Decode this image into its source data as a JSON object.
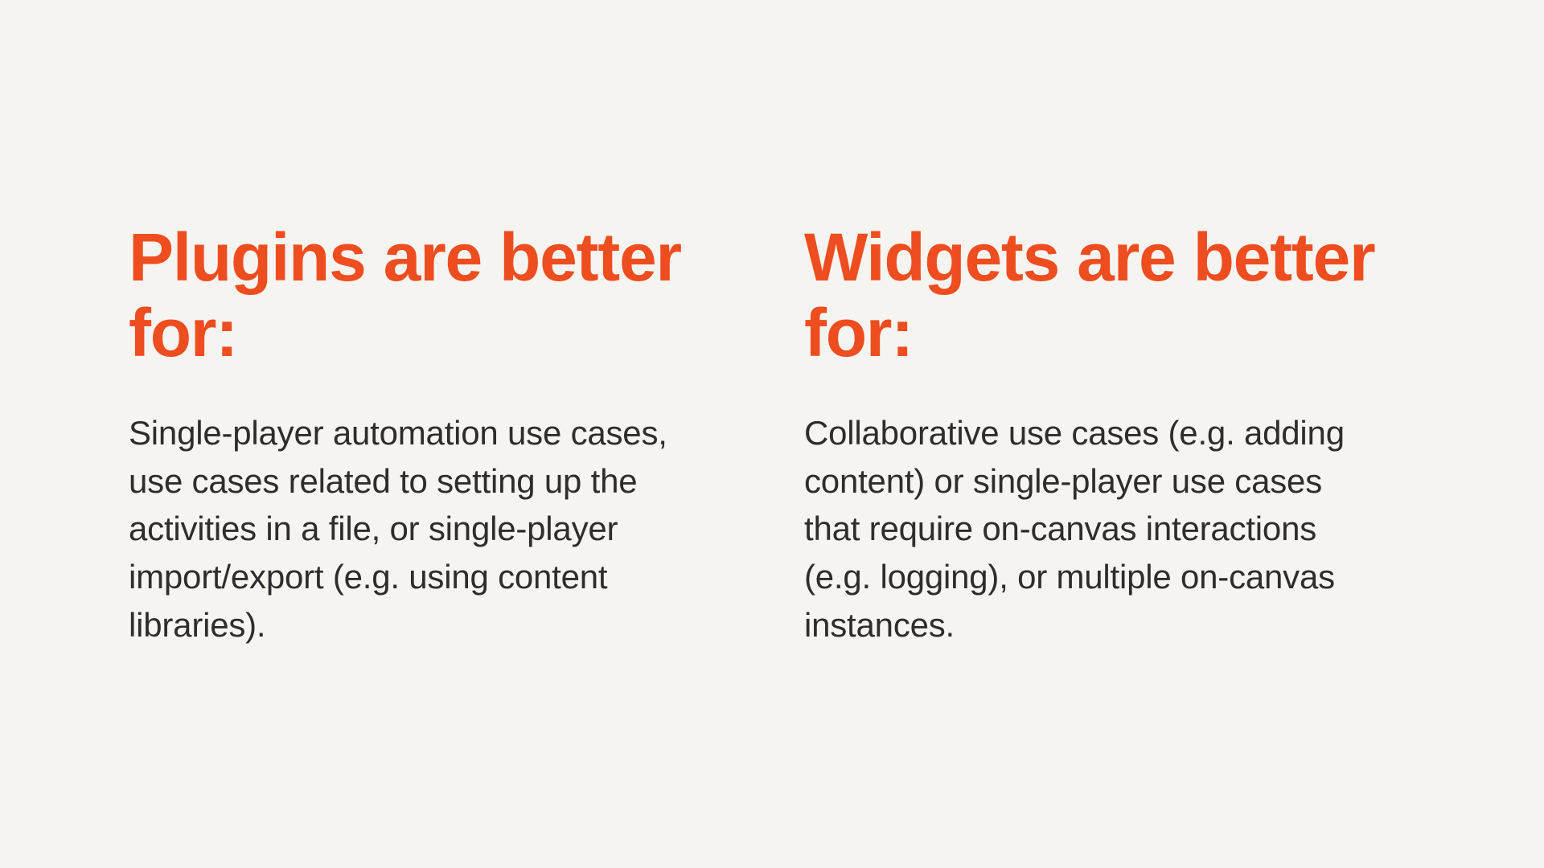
{
  "colors": {
    "background": "#f6f4f0",
    "heading": "#ee4d1f",
    "body": "#2d2d2d"
  },
  "columns": {
    "left": {
      "heading": "Plugins are better for:",
      "body": "Single-player automation use cases, use cases related to setting up the activities in a file, or single-player import/export (e.g. using content libraries)."
    },
    "right": {
      "heading": "Widgets are better for:",
      "body": "Collaborative use cases (e.g. adding content) or single-player use cases that require on-canvas interactions (e.g. logging), or multiple on-canvas instances."
    }
  }
}
